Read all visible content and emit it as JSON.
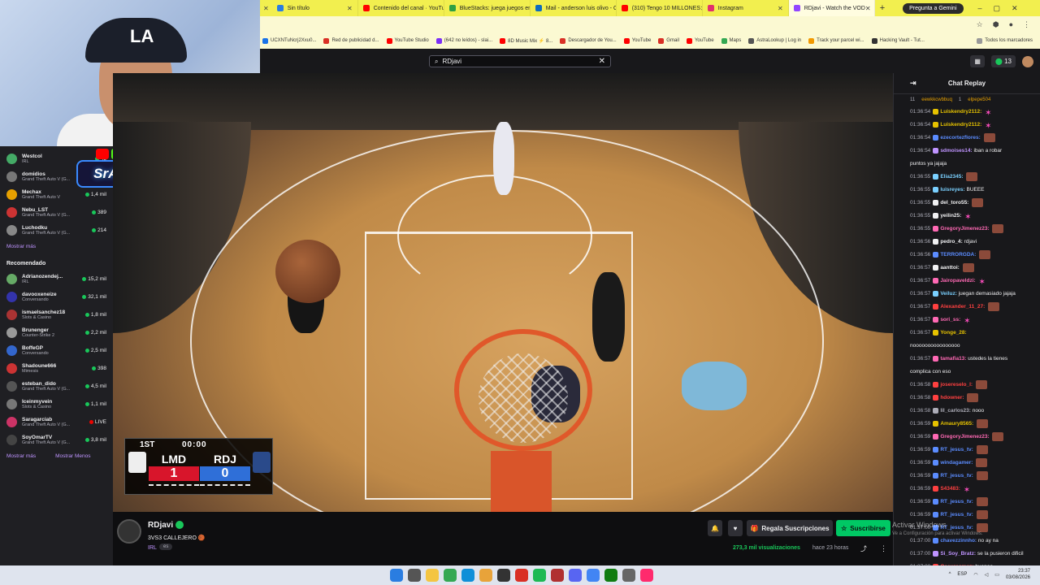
{
  "browser": {
    "tabs": [
      {
        "title": "Sin título",
        "color": "#2a7de1"
      },
      {
        "title": "Contenido del canal · YouTube",
        "color": "#ff0000"
      },
      {
        "title": "BlueStacks: juega juegos en PC",
        "color": "#2ea043"
      },
      {
        "title": "Mail - anderson luis olivo - Outlook",
        "color": "#0f6cbd"
      },
      {
        "title": "(310) Tengo 10 MILLONES",
        "color": "#ff0000"
      },
      {
        "title": "Instagram",
        "color": "#e1306c"
      },
      {
        "title": "RDjavi - Watch the VOD",
        "color": "#9146ff",
        "active": true
      }
    ],
    "gemini_label": "Pregunta a Gemini",
    "bookmarks": [
      {
        "label": "UCXNTuNcrj2Xxu0...",
        "color": "#1a73e8"
      },
      {
        "label": "Red de publicidad d...",
        "color": "#d93025"
      },
      {
        "label": "YouTube Studio",
        "color": "#ff0000"
      },
      {
        "label": "(642 no leídos) - slai...",
        "color": "#7b2ff7"
      },
      {
        "label": "8D Music Mix ⚡ 8...",
        "color": "#ff0000"
      },
      {
        "label": "Descargador de You...",
        "color": "#d93025"
      },
      {
        "label": "YouTube",
        "color": "#ff0000"
      },
      {
        "label": "Gmail",
        "color": "#d93025"
      },
      {
        "label": "YouTube",
        "color": "#ff0000"
      },
      {
        "label": "Maps",
        "color": "#34a853"
      },
      {
        "label": "AstraLookup | Log in",
        "color": "#555555"
      },
      {
        "label": "Track your parcel wi...",
        "color": "#f29900"
      },
      {
        "label": "Hacking Vault - Tut...",
        "color": "#333333"
      }
    ],
    "all_bookmarks": "Todos los marcadores"
  },
  "topnav": {
    "search_value": "RDjavi",
    "points": "13"
  },
  "overlay": {
    "brand": "SrAndersonL"
  },
  "sidebar": {
    "following": [
      {
        "name": "Westcol",
        "category": "IRL",
        "viewers": "45",
        "color": "#4a6"
      },
      {
        "name": "domidios",
        "category": "Grand Theft Auto V (G...",
        "viewers": "",
        "color": "#777"
      },
      {
        "name": "Mechax",
        "category": "Grand Theft Auto V",
        "viewers": "1,4 mil",
        "color": "#e6a000"
      },
      {
        "name": "Nebu_LST",
        "category": "Grand Theft Auto V (G...",
        "viewers": "389",
        "color": "#c33"
      },
      {
        "name": "Luchodku",
        "category": "Grand Theft Auto V (G...",
        "viewers": "214",
        "color": "#888"
      }
    ],
    "show_more": "Mostrar más",
    "recommended_title": "Recomendado",
    "recommended": [
      {
        "name": "Adrianozendej...",
        "category": "IRL",
        "viewers": "15,2 mil",
        "color": "#6a6"
      },
      {
        "name": "davooxeneize",
        "category": "Conversando",
        "viewers": "32,1 mil",
        "color": "#33a"
      },
      {
        "name": "ismaelsanchez18",
        "category": "Slots & Casino",
        "viewers": "1,8 mil",
        "color": "#a33"
      },
      {
        "name": "Brunenger",
        "category": "Counter-Strike 2",
        "viewers": "2,2 mil",
        "color": "#999"
      },
      {
        "name": "BoffeGP",
        "category": "Conversando",
        "viewers": "2,5 mil",
        "color": "#36c"
      },
      {
        "name": "Shadoune666",
        "category": "Mimesis",
        "viewers": "398",
        "color": "#c33"
      },
      {
        "name": "esteban_dido",
        "category": "Grand Theft Auto V (G...",
        "viewers": "4,5 mil",
        "color": "#555"
      },
      {
        "name": "Iceinmyvein",
        "category": "Slots & Casino",
        "viewers": "1,1 mil",
        "color": "#777"
      },
      {
        "name": "Saragarciab",
        "category": "Grand Theft Auto V (G...",
        "viewers": "LIVE",
        "color": "#c36"
      },
      {
        "name": "SoyOmarTV",
        "category": "Grand Theft Auto V (G...",
        "viewers": "3,8 mil",
        "color": "#444"
      }
    ],
    "show_more2": "Mostrar más",
    "show_less": "Mostrar Menos"
  },
  "scoreboard": {
    "period": "1ST",
    "clock": "00:00",
    "team1": "LMD",
    "team2": "RDJ",
    "score1": "1",
    "score2": "0"
  },
  "channel": {
    "name": "RDjavi",
    "title": "3VS3 CALLEJERO 🏀",
    "category": "IRL",
    "tag": "es",
    "gift_label": "Regala Suscripciones",
    "subscribe_label": "Suscribirse",
    "views": "273,3 mil visualizaciones",
    "ago": "hace 23 horas"
  },
  "chat": {
    "title": "Chat Replay",
    "pinned": [
      "11",
      "eewkkcwbbuq",
      "1",
      "elpepe504"
    ],
    "messages": [
      {
        "time": "01:36:54",
        "user": "Luiskendry2112:",
        "color": "#e6c200",
        "text": "",
        "emote": "pink"
      },
      {
        "time": "01:36:54",
        "user": "Luiskendry2112:",
        "color": "#e6c200",
        "text": "",
        "emote": "pink"
      },
      {
        "time": "01:36:54",
        "user": "ezecortezflores:",
        "color": "#5b8cff",
        "text": "",
        "emote": "face"
      },
      {
        "time": "01:36:54",
        "user": "sdmoises14:",
        "color": "#bf94ff",
        "text": "iban a robar",
        "emote": ""
      },
      {
        "time": "",
        "user": "",
        "color": "#efeff1",
        "text": "puntos ya jajaja",
        "emote": ""
      },
      {
        "time": "01:36:55",
        "user": "Elia2345:",
        "color": "#7ad0ff",
        "text": "",
        "emote": "face"
      },
      {
        "time": "01:36:55",
        "user": "luisreyes:",
        "color": "#7ad0ff",
        "text": "BUEEE",
        "emote": ""
      },
      {
        "time": "01:36:55",
        "user": "del_toro55:",
        "color": "#efeff1",
        "text": "",
        "emote": "face"
      },
      {
        "time": "01:36:55",
        "user": "yeilin25:",
        "color": "#efeff1",
        "text": "",
        "emote": "pink"
      },
      {
        "time": "01:36:55",
        "user": "GregoryJimenez23:",
        "color": "#ff69b4",
        "text": "",
        "emote": "face"
      },
      {
        "time": "01:36:56",
        "user": "pedro_4:",
        "color": "#efeff1",
        "text": "rdjavi",
        "emote": ""
      },
      {
        "time": "01:36:56",
        "user": "TERRORGDA:",
        "color": "#5b8cff",
        "text": "",
        "emote": "face"
      },
      {
        "time": "01:36:57",
        "user": "aanttoi:",
        "color": "#efeff1",
        "text": "",
        "emote": "face"
      },
      {
        "time": "01:36:57",
        "user": "Jairopaveldzi:",
        "color": "#ff69b4",
        "text": "",
        "emote": "pink"
      },
      {
        "time": "01:36:57",
        "user": "Veiluz:",
        "color": "#7ad0ff",
        "text": "juegan demasiado jajaja",
        "emote": ""
      },
      {
        "time": "01:36:57",
        "user": "Alexander_11_27:",
        "color": "#ff4040",
        "text": "",
        "emote": "face"
      },
      {
        "time": "01:36:57",
        "user": "sori_ss:",
        "color": "#ff69b4",
        "text": "",
        "emote": "pink"
      },
      {
        "time": "01:36:57",
        "user": "Yonge_28:",
        "color": "#e6c200",
        "text": "",
        "emote": ""
      },
      {
        "time": "",
        "user": "",
        "color": "#efeff1",
        "text": "noooooooooooooooo",
        "emote": ""
      },
      {
        "time": "01:36:57",
        "user": "tamafia13:",
        "color": "#ff69b4",
        "text": "ustedes la tienes",
        "emote": ""
      },
      {
        "time": "",
        "user": "",
        "color": "#efeff1",
        "text": "complica con eso",
        "emote": ""
      },
      {
        "time": "01:36:58",
        "user": "josereselo_l:",
        "color": "#ff4040",
        "text": "",
        "emote": "face"
      },
      {
        "time": "01:36:58",
        "user": "hdowner:",
        "color": "#ff4040",
        "text": "",
        "emote": "face"
      },
      {
        "time": "01:36:58",
        "user": "lil_carlos23:",
        "color": "#adadb8",
        "text": "nooo",
        "emote": ""
      },
      {
        "time": "01:36:59",
        "user": "Amaury8565:",
        "color": "#e6c200",
        "text": "",
        "emote": "face"
      },
      {
        "time": "01:36:59",
        "user": "GregoryJimenez23:",
        "color": "#ff69b4",
        "text": "",
        "emote": "face"
      },
      {
        "time": "01:36:59",
        "user": "RT_jesus_tv:",
        "color": "#5b8cff",
        "text": "",
        "emote": "face"
      },
      {
        "time": "01:36:59",
        "user": "windagamer:",
        "color": "#5b8cff",
        "text": "",
        "emote": "face"
      },
      {
        "time": "01:36:59",
        "user": "RT_jesus_tv:",
        "color": "#5b8cff",
        "text": "",
        "emote": "face"
      },
      {
        "time": "01:36:59",
        "user": "S43483:",
        "color": "#ff4040",
        "text": "",
        "emote": "pink"
      },
      {
        "time": "01:36:59",
        "user": "RT_jesus_tv:",
        "color": "#5b8cff",
        "text": "",
        "emote": "face"
      },
      {
        "time": "01:36:59",
        "user": "RT_jesus_tv:",
        "color": "#5b8cff",
        "text": "",
        "emote": "face"
      },
      {
        "time": "01:37:00",
        "user": "RT_jesus_tv:",
        "color": "#5b8cff",
        "text": "",
        "emote": "face"
      },
      {
        "time": "01:37:00",
        "user": "chavezzinnho:",
        "color": "#5b8cff",
        "text": "no ay na",
        "emote": ""
      },
      {
        "time": "01:37:00",
        "user": "Si_Soy_Bratz:",
        "color": "#bf94ff",
        "text": "se la pusieron dificil",
        "emote": ""
      },
      {
        "time": "01:37:00",
        "user": "Oscureomez:",
        "color": "#ff4040",
        "text": "buenoo",
        "emote": ""
      }
    ]
  },
  "system": {
    "activate": "Activar Windows",
    "activate_sub": "Ve a Configuración para activar Windows.",
    "lang": "ESP",
    "time": "23:37",
    "date": "03/08/2026"
  }
}
